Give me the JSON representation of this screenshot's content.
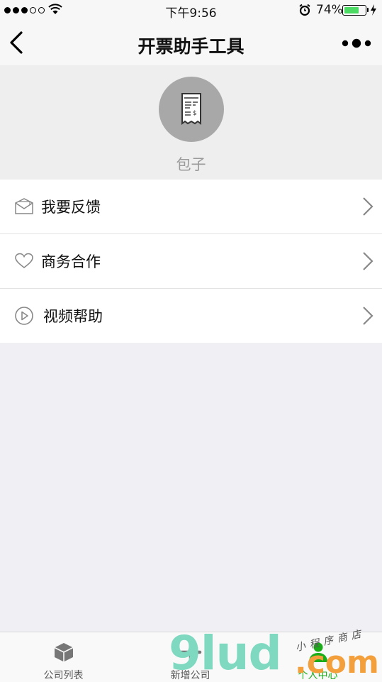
{
  "status_bar": {
    "time": "下午9:56",
    "battery_percent": "74%",
    "battery_level": 0.74
  },
  "nav": {
    "title": "开票助手工具"
  },
  "profile": {
    "nickname": "包子"
  },
  "menu": [
    {
      "label": "我要反馈",
      "icon": "mail-icon"
    },
    {
      "label": "商务合作",
      "icon": "heart-icon"
    },
    {
      "label": "视频帮助",
      "icon": "play-circle-icon"
    }
  ],
  "tabs": [
    {
      "label": "公司列表",
      "icon": "box-icon",
      "active": false
    },
    {
      "label": "新增公司",
      "icon": "plus-icon",
      "active": false
    },
    {
      "label": "个人中心",
      "icon": "person-icon",
      "active": true
    }
  ],
  "watermark": {
    "main": "9lud",
    "com": ".com",
    "sub": "小程序商店"
  },
  "colors": {
    "accent": "#1aad19",
    "battery": "#4cd964",
    "avatar_bg": "#a8a8a8"
  }
}
